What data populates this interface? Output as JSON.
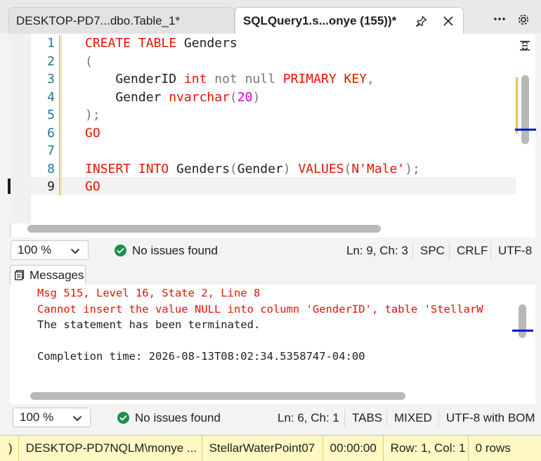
{
  "tabs": [
    {
      "label": "DESKTOP-PD7...dbo.Table_1*"
    },
    {
      "label": "SQLQuery1.s...onye (155))*"
    }
  ],
  "editor": {
    "line_numbers": [
      "1",
      "2",
      "3",
      "4",
      "5",
      "6",
      "7",
      "8",
      "9"
    ],
    "active_line": "9",
    "lines": [
      [
        {
          "t": "CREATE TABLE ",
          "c": "k"
        },
        {
          "t": "Genders",
          "c": "d"
        }
      ],
      [
        {
          "t": "(",
          "c": "g"
        }
      ],
      [
        {
          "t": "    GenderID ",
          "c": "d"
        },
        {
          "t": "int ",
          "c": "k"
        },
        {
          "t": "not null ",
          "c": "g"
        },
        {
          "t": "PRIMARY KEY",
          "c": "k"
        },
        {
          "t": ",",
          "c": "g"
        }
      ],
      [
        {
          "t": "    Gender ",
          "c": "d"
        },
        {
          "t": "nvarchar",
          "c": "k"
        },
        {
          "t": "(",
          "c": "g"
        },
        {
          "t": "20",
          "c": "n"
        },
        {
          "t": ")",
          "c": "g"
        }
      ],
      [
        {
          "t": ");",
          "c": "g"
        }
      ],
      [
        {
          "t": "GO",
          "c": "k"
        }
      ],
      [],
      [
        {
          "t": "INSERT INTO ",
          "c": "k"
        },
        {
          "t": "Genders",
          "c": "d"
        },
        {
          "t": "(",
          "c": "g"
        },
        {
          "t": "Gender",
          "c": "d"
        },
        {
          "t": ") ",
          "c": "g"
        },
        {
          "t": "VALUES",
          "c": "k"
        },
        {
          "t": "(",
          "c": "g"
        },
        {
          "t": "N'Male'",
          "c": "k"
        },
        {
          "t": ");",
          "c": "g"
        }
      ],
      [
        {
          "t": "GO",
          "c": "k"
        }
      ]
    ]
  },
  "editor_status": {
    "zoom": "100 %",
    "issues": "No issues found",
    "position": "Ln: 9, Ch: 3",
    "indent": "SPC",
    "eol": "CRLF",
    "encoding": "UTF-8"
  },
  "messages": {
    "tab_label": "Messages",
    "lines": [
      {
        "text": "Msg 515, Level 16, State 2, Line 8",
        "type": "error"
      },
      {
        "text": "Cannot insert the value NULL into column 'GenderID', table 'StellarW",
        "type": "error"
      },
      {
        "text": "The statement has been terminated.",
        "type": "info"
      },
      {
        "text": "",
        "type": "info"
      },
      {
        "text": "Completion time: 2026-08-13T08:02:34.5358747-04:00",
        "type": "info"
      }
    ]
  },
  "messages_status": {
    "zoom": "100 %",
    "issues": "No issues found",
    "position": "Ln: 6, Ch: 1",
    "indent": "TABS",
    "eol": "MIXED",
    "encoding": "UTF-8 with BOM"
  },
  "connection_bar": {
    "left_fragment": ")",
    "server_user": "DESKTOP-PD7NQLM\\monye ...",
    "database": "StellarWaterPoint07",
    "elapsed": "00:00:00",
    "cursor": "Row: 1, Col: 1",
    "rows": "0 rows"
  },
  "colors": {
    "keyword": "#e51400",
    "gray_syntax": "#777777",
    "number": "#d400d4",
    "line_number": "#237893",
    "status_bar": "#fff9c4",
    "issue_ok": "#1e8f4e"
  },
  "icons": [
    "pin-icon",
    "close-icon",
    "more-icon",
    "gear-icon",
    "split-icon",
    "chevron-down-icon",
    "check-circle-icon",
    "messages-icon"
  ]
}
